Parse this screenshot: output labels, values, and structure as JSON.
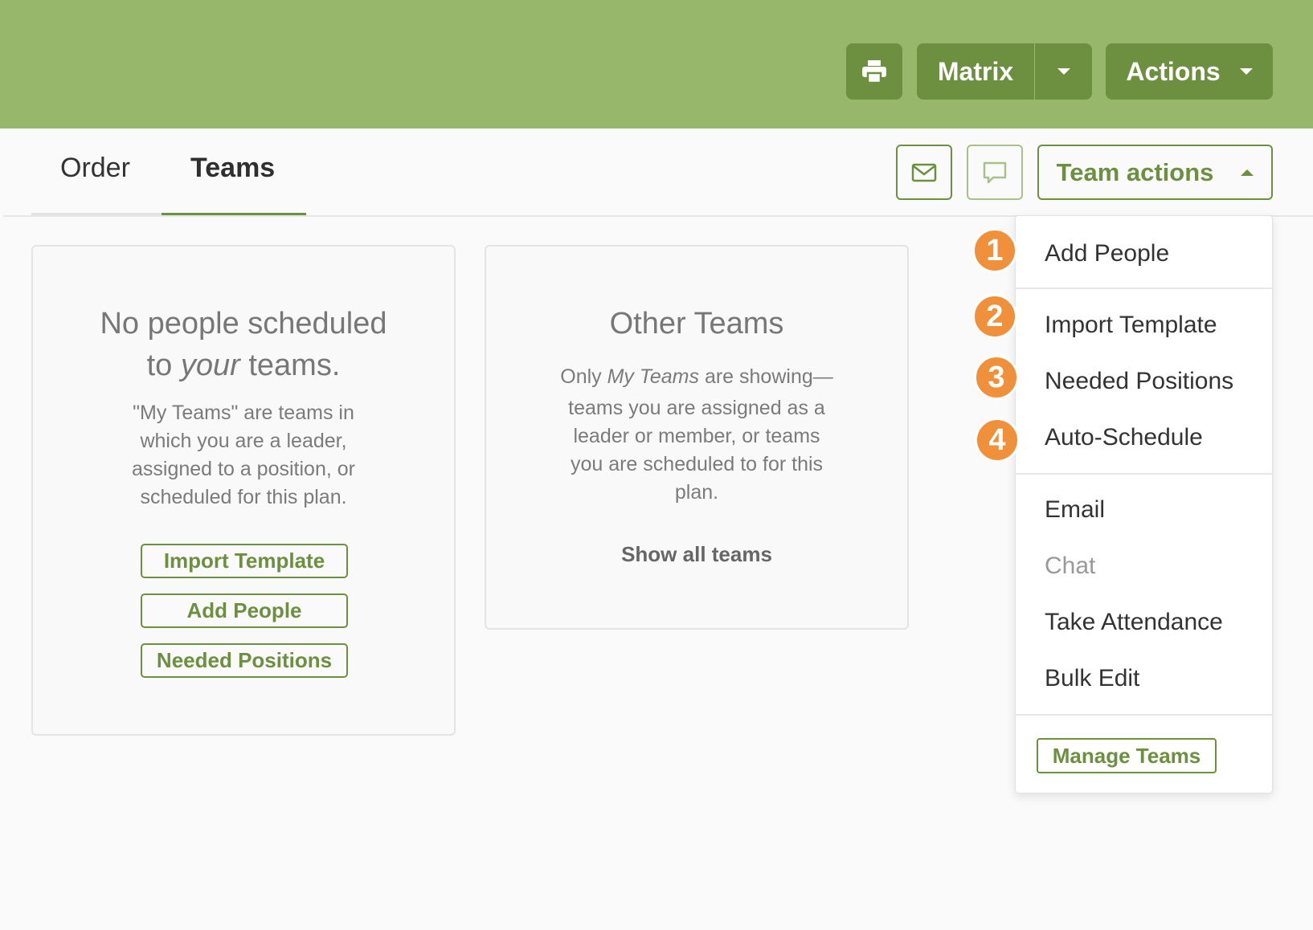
{
  "header": {
    "matrix_label": "Matrix",
    "actions_label": "Actions",
    "print_icon": "printer-icon"
  },
  "tabs": [
    {
      "label": "Order",
      "active": false
    },
    {
      "label": "Teams",
      "active": true
    }
  ],
  "toolbar": {
    "email_icon": "envelope-icon",
    "chat_icon": "chat-bubble-icon",
    "team_actions_label": "Team actions"
  },
  "my_teams_card": {
    "title_part1": "No people scheduled",
    "title_part2_pre": "to ",
    "title_part2_em": "your",
    "title_part2_post": " teams.",
    "body_line1": "\"My Teams\" are teams in",
    "body_line2": "which you are a leader,",
    "body_line3": "assigned to a position, or",
    "body_line4": "scheduled for this plan.",
    "buttons": [
      "Import Template",
      "Add People",
      "Needed Positions"
    ]
  },
  "other_teams_card": {
    "title": "Other Teams",
    "body_pre": "Only ",
    "body_em": "My Teams",
    "body_post": " are showing—",
    "body_line2": "teams you are assigned as a",
    "body_line3": "leader or member, or teams",
    "body_line4": "you are scheduled to for this",
    "body_line5": "plan.",
    "show_all": "Show all teams"
  },
  "team_actions_menu": {
    "items": [
      {
        "label": "Add People",
        "disabled": false
      },
      {
        "label": "Import Template",
        "disabled": false
      },
      {
        "label": "Needed Positions",
        "disabled": false
      },
      {
        "label": "Auto-Schedule",
        "disabled": false
      },
      {
        "label": "Email",
        "disabled": false
      },
      {
        "label": "Chat",
        "disabled": true
      },
      {
        "label": "Take Attendance",
        "disabled": false
      },
      {
        "label": "Bulk Edit",
        "disabled": false
      }
    ],
    "manage_label": "Manage Teams"
  },
  "callouts": [
    "1",
    "2",
    "3",
    "4"
  ],
  "colors": {
    "header_green": "#97b86a",
    "button_green": "#6c9040",
    "callout_orange": "#f0903a"
  }
}
